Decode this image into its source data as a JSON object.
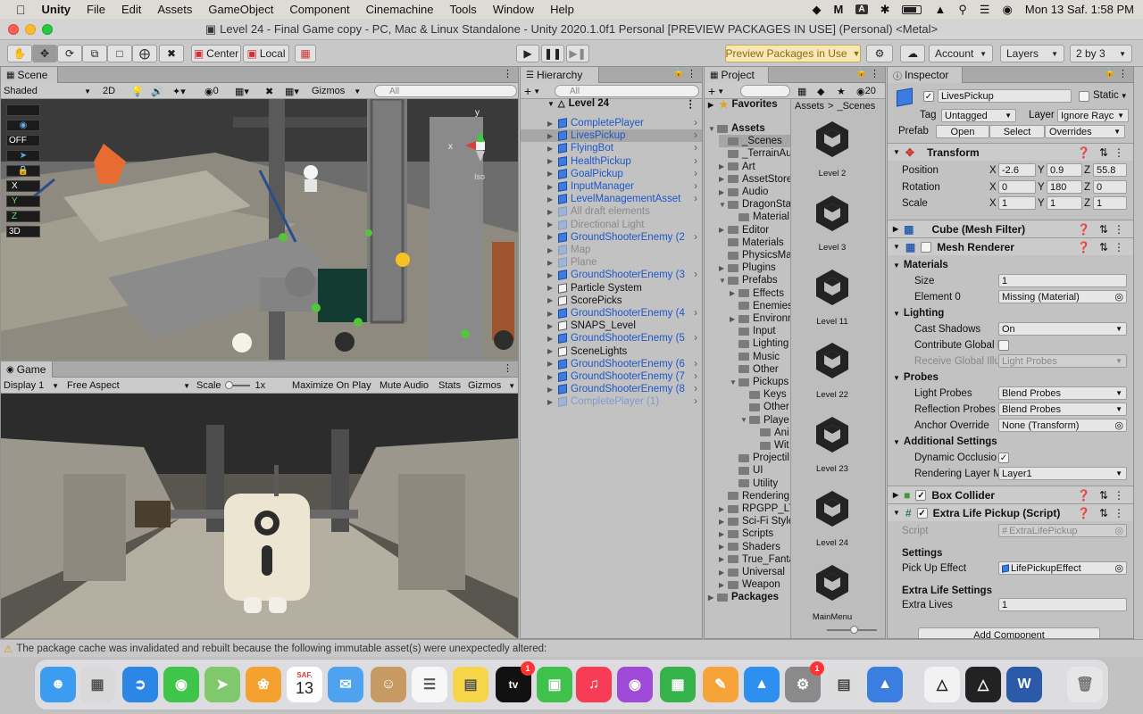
{
  "menubar": {
    "app": "Unity",
    "items": [
      "File",
      "Edit",
      "Assets",
      "GameObject",
      "Component",
      "Cinemachine",
      "Tools",
      "Window",
      "Help"
    ],
    "datetime": "Mon 13 Saf.  1:58 PM"
  },
  "window_title": "Level 24 - Final Game copy - PC, Mac & Linux Standalone - Unity 2020.1.0f1 Personal [PREVIEW PACKAGES IN USE] (Personal) <Metal>",
  "toolbar": {
    "pivot": "Center",
    "space": "Local",
    "preview_packages": "Preview Packages in Use",
    "account": "Account",
    "layers": "Layers",
    "layout": "2 by 3"
  },
  "scene": {
    "tab": "Scene",
    "shading": "Shaded",
    "mode_2d": "2D",
    "hidden_count": "0",
    "gizmos": "Gizmos",
    "search_placeholder": "All",
    "overlay_off": "OFF",
    "overlay_3d": "3D",
    "axis_y": "y",
    "axis_x": "x",
    "iso": "Iso"
  },
  "game": {
    "tab": "Game",
    "display": "Display 1",
    "aspect": "Free Aspect",
    "scale_label": "Scale",
    "scale_value": "1x",
    "maximize": "Maximize On Play",
    "mute": "Mute Audio",
    "stats": "Stats",
    "gizmos": "Gizmos"
  },
  "hierarchy": {
    "tab": "Hierarchy",
    "search_placeholder": "All",
    "scene_name": "Level 24",
    "items": [
      {
        "label": "CompletePlayer",
        "style": "prefab"
      },
      {
        "label": "LivesPickup",
        "style": "prefab"
      },
      {
        "label": "FlyingBot",
        "style": "prefab"
      },
      {
        "label": "HealthPickup",
        "style": "prefab"
      },
      {
        "label": "GoalPickup",
        "style": "prefab"
      },
      {
        "label": "InputManager",
        "style": "prefab"
      },
      {
        "label": "LevelManagementAsset",
        "style": "prefab"
      },
      {
        "label": "All draft elements",
        "style": "disabled"
      },
      {
        "label": "Directional Light",
        "style": "disabled"
      },
      {
        "label": "GroundShooterEnemy (2",
        "style": "prefab"
      },
      {
        "label": "Map",
        "style": "disabled"
      },
      {
        "label": "Plane",
        "style": "disabled"
      },
      {
        "label": "GroundShooterEnemy (3",
        "style": "prefab"
      },
      {
        "label": "Particle System",
        "style": "normal"
      },
      {
        "label": "ScorePicks",
        "style": "normal"
      },
      {
        "label": "GroundShooterEnemy (4",
        "style": "prefab"
      },
      {
        "label": "SNAPS_Level",
        "style": "normal"
      },
      {
        "label": "GroundShooterEnemy (5",
        "style": "prefab"
      },
      {
        "label": "SceneLights",
        "style": "normal"
      },
      {
        "label": "GroundShooterEnemy (6",
        "style": "prefab"
      },
      {
        "label": "GroundShooterEnemy (7",
        "style": "prefab"
      },
      {
        "label": "GroundShooterEnemy (8",
        "style": "prefab"
      },
      {
        "label": "CompletePlayer (1)",
        "style": "prefab-disabled"
      }
    ]
  },
  "project": {
    "tab": "Project",
    "hidden_count": "20",
    "favorites": "Favorites",
    "breadcrumb_root": "Assets",
    "breadcrumb_current": "_Scenes",
    "tree": [
      {
        "label": "Assets",
        "level": 0,
        "open": true,
        "bold": true
      },
      {
        "label": "_Scenes",
        "level": 1
      },
      {
        "label": "_TerrainAu",
        "level": 1
      },
      {
        "label": "Art",
        "level": 1,
        "arrow": true
      },
      {
        "label": "AssetStore",
        "level": 1,
        "arrow": true
      },
      {
        "label": "Audio",
        "level": 1,
        "arrow": true
      },
      {
        "label": "DragonSta",
        "level": 1,
        "open": true
      },
      {
        "label": "Material",
        "level": 2
      },
      {
        "label": "Editor",
        "level": 1,
        "arrow": true
      },
      {
        "label": "Materials",
        "level": 1
      },
      {
        "label": "PhysicsMa",
        "level": 1
      },
      {
        "label": "Plugins",
        "level": 1,
        "arrow": true
      },
      {
        "label": "Prefabs",
        "level": 1,
        "open": true
      },
      {
        "label": "Effects",
        "level": 2,
        "arrow": true
      },
      {
        "label": "Enemies",
        "level": 2
      },
      {
        "label": "Environn",
        "level": 2,
        "arrow": true
      },
      {
        "label": "Input",
        "level": 2
      },
      {
        "label": "Lighting",
        "level": 2
      },
      {
        "label": "Music",
        "level": 2
      },
      {
        "label": "Other",
        "level": 2
      },
      {
        "label": "Pickups",
        "level": 2,
        "open": true
      },
      {
        "label": "Keys",
        "level": 3
      },
      {
        "label": "Other",
        "level": 3
      },
      {
        "label": "Playe",
        "level": 3,
        "open": true
      },
      {
        "label": "Ani",
        "level": 4
      },
      {
        "label": "Wit",
        "level": 4
      },
      {
        "label": "Projectil",
        "level": 2
      },
      {
        "label": "UI",
        "level": 2
      },
      {
        "label": "Utility",
        "level": 2
      },
      {
        "label": "Rendering",
        "level": 1
      },
      {
        "label": "RPGPP_LT",
        "level": 1,
        "arrow": true
      },
      {
        "label": "Sci-Fi Style",
        "level": 1,
        "arrow": true
      },
      {
        "label": "Scripts",
        "level": 1,
        "arrow": true
      },
      {
        "label": "Shaders",
        "level": 1,
        "arrow": true
      },
      {
        "label": "True_Fanta",
        "level": 1,
        "arrow": true
      },
      {
        "label": "Universal",
        "level": 1,
        "arrow": true
      },
      {
        "label": "Weapon",
        "level": 1,
        "arrow": true
      },
      {
        "label": "Packages",
        "level": 0,
        "bold": true,
        "arrow": true
      }
    ],
    "assets": [
      "Level 2",
      "Level 3",
      "Level 11",
      "Level 22",
      "Level 23",
      "Level 24",
      "MainMenu"
    ]
  },
  "inspector": {
    "tab": "Inspector",
    "object_name": "LivesPickup",
    "static_label": "Static",
    "tag_label": "Tag",
    "tag_value": "Untagged",
    "layer_label": "Layer",
    "layer_value": "Ignore Rayc",
    "prefab_label": "Prefab",
    "prefab_open": "Open",
    "prefab_select": "Select",
    "prefab_overrides": "Overrides",
    "transform": {
      "title": "Transform",
      "position_label": "Position",
      "position": {
        "x": "-2.6",
        "y": "0.9",
        "z": "55.8"
      },
      "rotation_label": "Rotation",
      "rotation": {
        "x": "0",
        "y": "180",
        "z": "0"
      },
      "scale_label": "Scale",
      "scale": {
        "x": "1",
        "y": "1",
        "z": "1"
      }
    },
    "mesh_filter_title": "Cube (Mesh Filter)",
    "mesh_renderer": {
      "title": "Mesh Renderer",
      "materials": "Materials",
      "size_label": "Size",
      "size": "1",
      "element0_label": "Element 0",
      "element0": "Missing (Material)",
      "lighting": "Lighting",
      "cast_shadows_label": "Cast Shadows",
      "cast_shadows": "On",
      "contribute_gi_label": "Contribute Global I",
      "receive_gi_label": "Receive Global Illu",
      "receive_gi": "Light Probes",
      "probes": "Probes",
      "light_probes_label": "Light Probes",
      "light_probes": "Blend Probes",
      "reflection_probes_label": "Reflection Probes",
      "reflection_probes": "Blend Probes",
      "anchor_label": "Anchor Override",
      "anchor": "None (Transform)",
      "additional": "Additional Settings",
      "dynamic_occlusion_label": "Dynamic Occlusio",
      "rendering_layer_label": "Rendering Layer M",
      "rendering_layer": "Layer1"
    },
    "box_collider_title": "Box Collider",
    "script_component": {
      "title": "Extra Life Pickup (Script)",
      "script_label": "Script",
      "script": "ExtraLifePickup",
      "settings": "Settings",
      "pickup_effect_label": "Pick Up Effect",
      "pickup_effect": "LifePickupEffect",
      "extra_life_settings": "Extra Life Settings",
      "extra_lives_label": "Extra Lives",
      "extra_lives": "1"
    },
    "add_component": "Add Component"
  },
  "status_message": "The package cache was invalidated and rebuilt because the following immutable asset(s) were unexpectedly altered:",
  "dock": {
    "calendar_month": "SAF.",
    "calendar_day": "13",
    "badge_tv": "1",
    "badge_settings": "1"
  }
}
